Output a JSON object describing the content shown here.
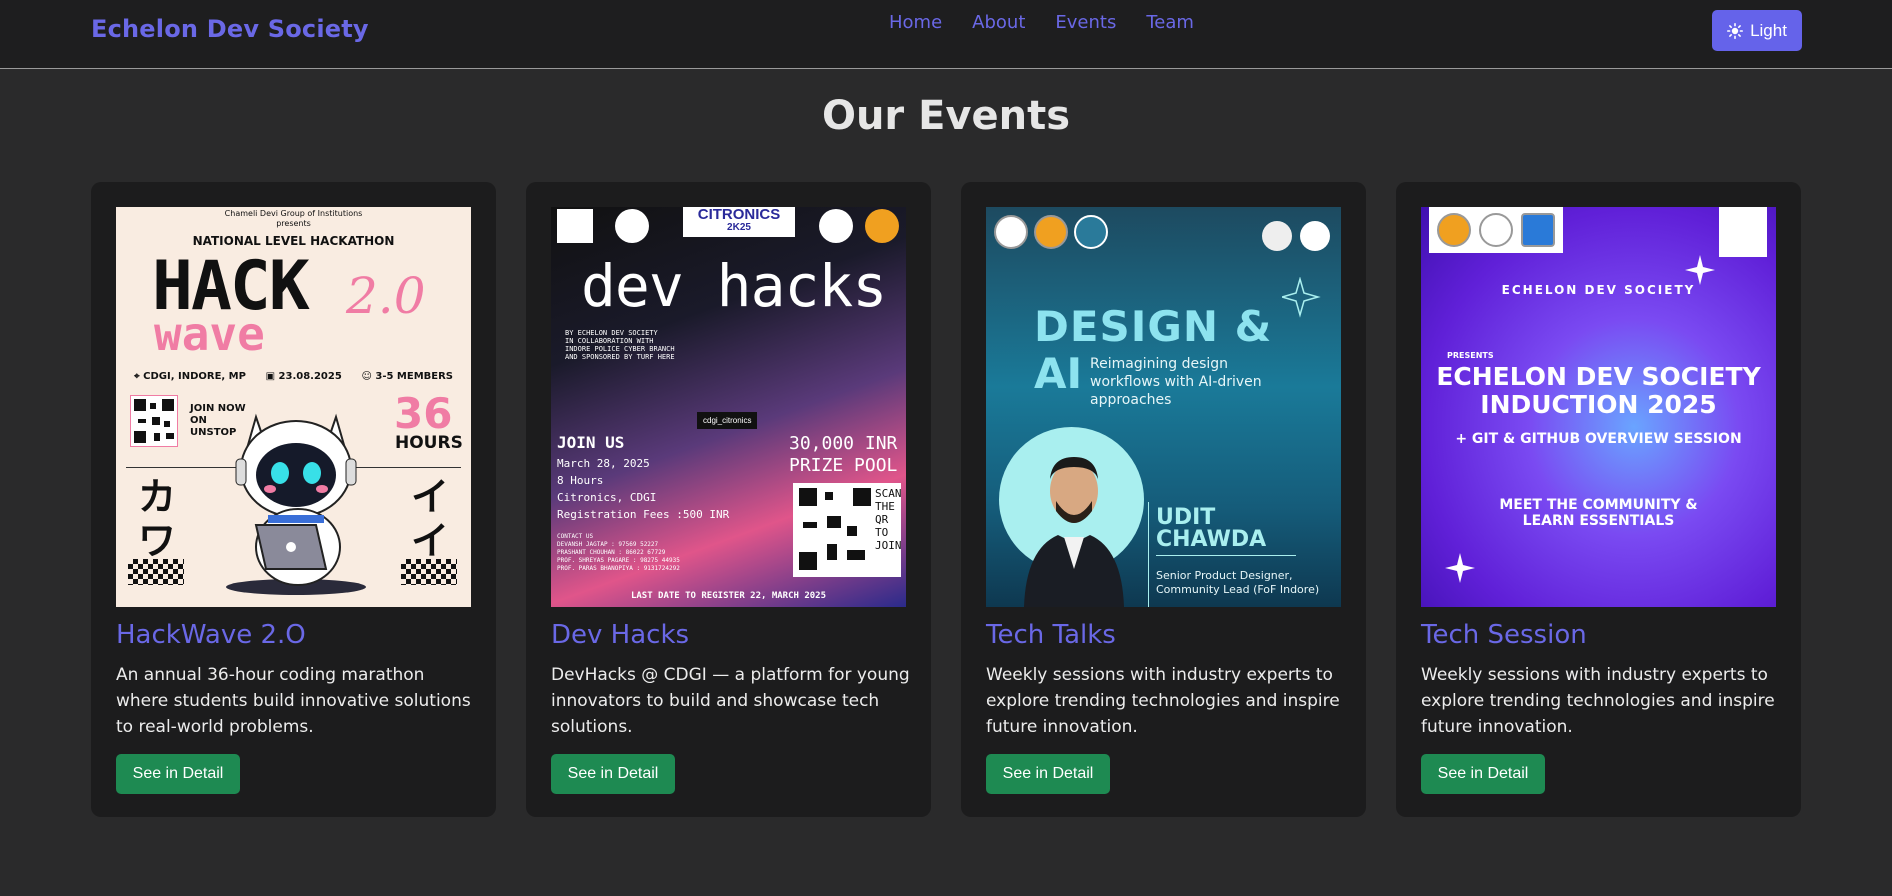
{
  "navbar": {
    "brand": "Echelon Dev Society",
    "links": [
      "Home",
      "About",
      "Events",
      "Team"
    ],
    "theme_button": "Light"
  },
  "page_title": "Our Events",
  "events": [
    {
      "title": "HackWave 2.O",
      "description": "An annual 36-hour coding marathon where students build innovative solutions to real-world problems.",
      "button": "See in Detail",
      "poster": {
        "org": "Chameli Devi Group of Institutions",
        "presents": "presents",
        "heading": "NATIONAL LEVEL HACKATHON",
        "word1": "HACK",
        "word2": "wave",
        "version": "2.0",
        "location": "CDGI, INDORE, MP",
        "date": "23.08.2025",
        "members": "3-5 MEMBERS",
        "join_lines": [
          "JOIN NOW",
          "ON",
          "UNSTOP"
        ],
        "hours_num": "36",
        "hours_label": "HOURS",
        "kata_left": [
          "カ",
          "ワ"
        ],
        "kata_right": [
          "イ",
          "イ"
        ]
      }
    },
    {
      "title": "Dev Hacks",
      "description": "DevHacks @ CDGI — a platform for young innovators to build and showcase tech solutions.",
      "button": "See in Detail",
      "poster": {
        "title": "dev hacks",
        "sponsor_lines": [
          "BY ECHELON DEV SOCIETY",
          "IN COLLABORATION WITH",
          "INDORE POLICE CYBER BRANCH",
          "AND SPONSORED BY TURF HERE"
        ],
        "join": "JOIN US",
        "info_lines": [
          "March 28, 2025",
          "8 Hours",
          "Citronics, CDGI",
          "Registration Fees :500 INR"
        ],
        "contact_lines": [
          "CONTACT US",
          "DEVANSH JAGTAP : 97569 52227",
          "PRASHANT CHOUHAN : 86022 67729",
          "PROF. SHREYAS PAGARE : 98275 44935",
          "PROF. PARAS BHANOPIYA : 9131724292"
        ],
        "prize_lines": [
          "30,000 INR",
          "PRIZE POOL"
        ],
        "scan_lines": [
          "SCAN",
          "THE",
          "QR",
          "TO",
          "JOIN"
        ],
        "tag": "cdgi_citronics",
        "brand": "CITRONICS",
        "brand_year": "2K25",
        "last_date": "LAST DATE TO REGISTER 22, MARCH 2025"
      }
    },
    {
      "title": "Tech Talks",
      "description": "Weekly sessions with industry experts to explore trending technologies and inspire future innovation.",
      "button": "See in Detail",
      "poster": {
        "line1": "DESIGN &",
        "line2": "AI",
        "tagline": "Reimagining design workflows with AI-driven approaches",
        "speaker_first": "UDIT",
        "speaker_last": "CHAWDA",
        "role_lines": [
          "Senior Product Designer,",
          "Community Lead (FoF Indore)"
        ]
      }
    },
    {
      "title": "Tech Session",
      "description": "Weekly sessions with industry experts to explore trending technologies and inspire future innovation.",
      "button": "See in Detail",
      "poster": {
        "society": "ECHELON DEV SOCIETY",
        "presents": "PRESENTS",
        "headline_lines": [
          "ECHELON DEV SOCIETY",
          "INDUCTION 2025"
        ],
        "sub": "+ GIT & GITHUB OVERVIEW SESSION",
        "meet_lines": [
          "MEET THE COMMUNITY &",
          "LEARN ESSENTIALS"
        ]
      }
    }
  ],
  "colors": {
    "background": "#2a2a2b",
    "navbar": "#1e1e1f",
    "card": "#1c1c1d",
    "accent": "#6a68e6",
    "button_green": "#1e8a52"
  }
}
